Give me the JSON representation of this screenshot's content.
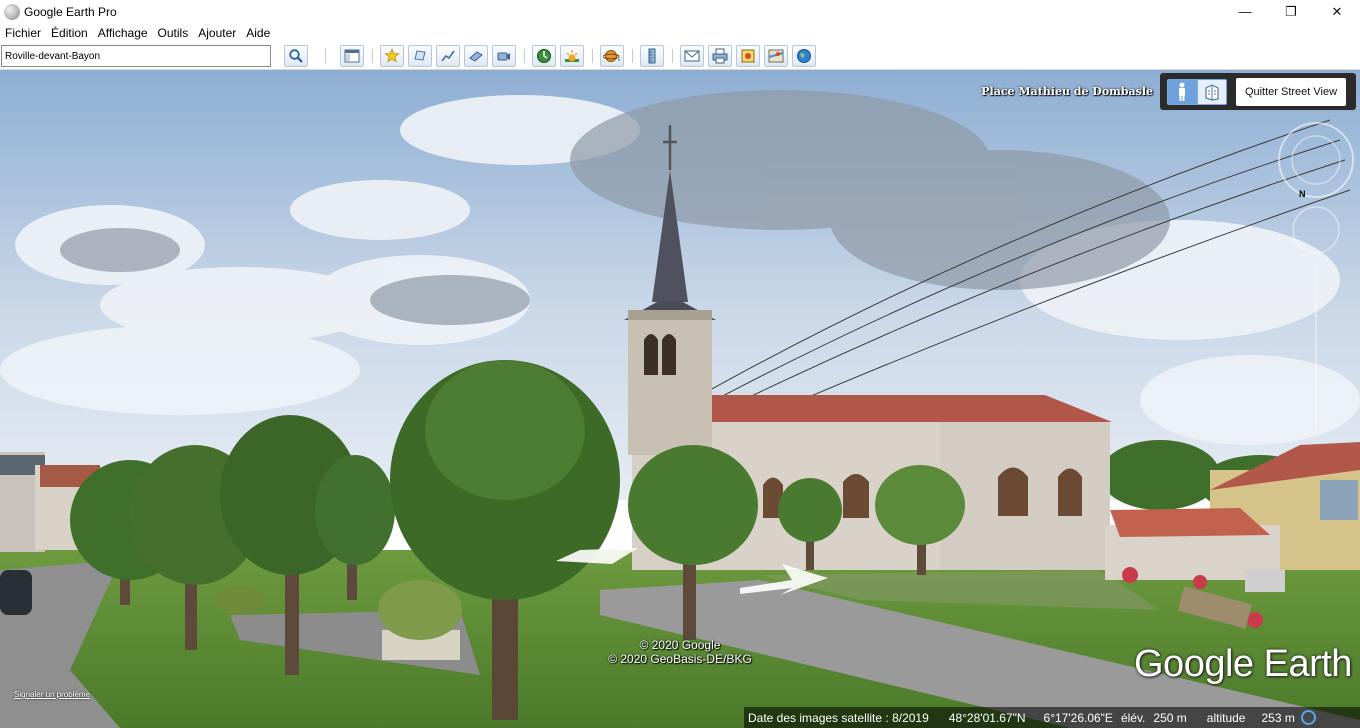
{
  "window": {
    "title": "Google Earth Pro",
    "controls": {
      "minimize": "—",
      "maximize": "❐",
      "close": "✕"
    }
  },
  "menu": {
    "items": [
      "Fichier",
      "Édition",
      "Affichage",
      "Outils",
      "Ajouter",
      "Aide"
    ]
  },
  "search": {
    "value": "Roville-devant-Bayon"
  },
  "toolbar": {
    "buttons": [
      "sidebar-icon",
      "placemark-icon",
      "polygon-icon",
      "path-icon",
      "image-overlay-icon",
      "record-tour-icon",
      "historical-imagery-icon",
      "sunlight-icon",
      "planets-icon",
      "ruler-icon",
      "email-icon",
      "print-icon",
      "save-image-icon",
      "view-in-maps-icon",
      "earth-icon"
    ]
  },
  "streetview": {
    "place_name": "Place Mathieu de Dombasle",
    "exit_label": "Quitter Street View",
    "compass_label": "N"
  },
  "credits": {
    "line1": "© 2020 Google",
    "line2": "© 2020 GeoBasis-DE/BKG"
  },
  "logo": "Google Earth",
  "report_link": "Signaler un problème",
  "status": {
    "imagery_date": "Date des images satellite : 8/2019",
    "latitude": "48°28'01.67\"N",
    "longitude": "6°17'26.06\"E",
    "elevation_label": "élév.",
    "elevation_value": "250 m",
    "altitude_label": "altitude",
    "altitude_value": "253 m"
  },
  "colors": {
    "sky": "#a9c0dc",
    "grass": "#5f8f3a",
    "church_wall": "#d9d2c9",
    "roof": "#b0574a",
    "accent_blue": "#59a7e8"
  }
}
